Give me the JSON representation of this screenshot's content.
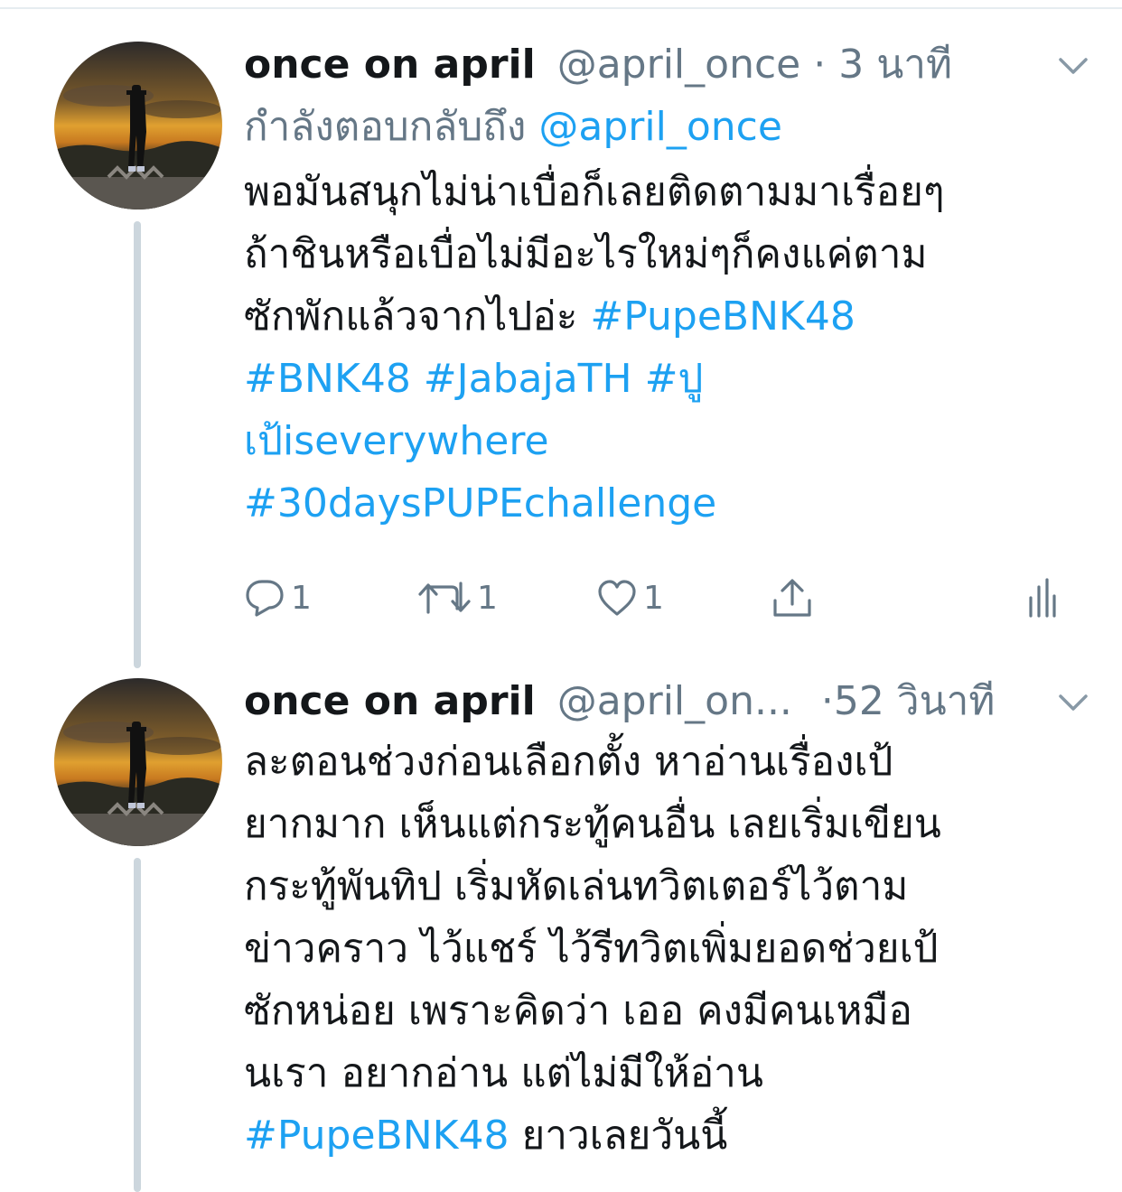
{
  "tweets": [
    {
      "name": "once on april",
      "handle": "@april_once",
      "dot": "·",
      "time": "3 นาที",
      "reply_prefix": "กำลังตอบกลับถึง",
      "reply_mention": "@april_once",
      "lines": [
        {
          "text": "พอมันสนุกไม่น่าเบื่อก็เลยติดตามมาเรื่อยๆ",
          "tag": ""
        },
        {
          "text": "ถ้าชินหรือเบื่อไม่มีอะไรใหม่ๆก็คงแค่ตาม",
          "tag": ""
        },
        {
          "text": "ซักพักแล้วจากไปอ่ะ ",
          "tag": "#PupeBNK48"
        },
        {
          "text": "",
          "tag": "#BNK48 #JabajaTH #ปู"
        },
        {
          "text": "",
          "tag": "เป้iseverywhere"
        },
        {
          "text": "",
          "tag": "#30daysPUPEchallenge"
        }
      ],
      "actions": {
        "reply_count": "1",
        "retweet_count": "1",
        "like_count": "1"
      }
    },
    {
      "name": "once on april",
      "handle": "@april_on...",
      "dot": "·",
      "time": "52 วินาที",
      "lines": [
        {
          "text": "ละตอนช่วงก่อนเลือกตั้ง หาอ่านเรื่องเป้",
          "tag": ""
        },
        {
          "text": "ยากมาก เห็นแต่กระทู้คนอื่น เลยเริ่มเขียน",
          "tag": ""
        },
        {
          "text": "กระทู้พันทิป เริ่มหัดเล่นทวิตเตอร์ไว้ตาม",
          "tag": ""
        },
        {
          "text": "ข่าวคราว ไว้แชร์ ไว้รีทวิตเพิ่มยอดช่วยเป้",
          "tag": ""
        },
        {
          "text": "ซักหน่อย เพราะคิดว่า เออ คงมีคนเหมือ",
          "tag": ""
        },
        {
          "text": "นเรา อยากอ่าน แต่ไม่มีให้อ่าน",
          "tag": ""
        },
        {
          "text": " ยาวเลยวันนี้",
          "tag": "#PupeBNK48",
          "tag_first": true
        }
      ]
    }
  ],
  "icons": {
    "caret": "chevron-down-icon",
    "reply": "reply-icon",
    "retweet": "retweet-icon",
    "like": "heart-icon",
    "share": "share-icon",
    "analytics": "analytics-icon"
  },
  "colors": {
    "link": "#1da1f2",
    "secondary": "#657786",
    "text": "#14171a",
    "thread_line": "#ccd6dd"
  }
}
